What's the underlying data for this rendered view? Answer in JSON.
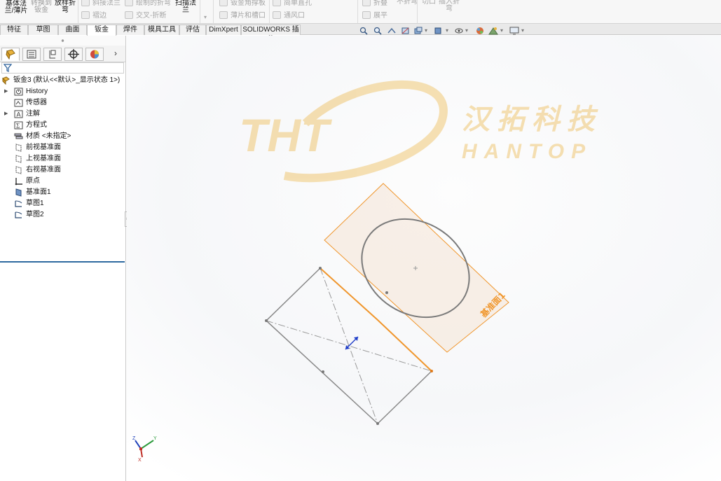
{
  "ribbon": {
    "big_buttons": [
      {
        "label": "基体法\n兰/薄片",
        "faded": false
      },
      {
        "label": "转换到\n钣金",
        "faded": true
      },
      {
        "label": "放样折\n弯",
        "faded": false
      },
      {
        "label": "扫描法\n兰",
        "faded": false
      }
    ],
    "small_buttons": [
      {
        "label": "斜接法兰"
      },
      {
        "label": "褶边"
      },
      {
        "label": "绘制的折弯"
      },
      {
        "label": "交叉-折断"
      },
      {
        "label": "钣金角撑板"
      },
      {
        "label": "薄片和槽口"
      },
      {
        "label": "简单直孔"
      },
      {
        "label": "通风口"
      },
      {
        "label": "折叠"
      },
      {
        "label": "不折弯"
      },
      {
        "label": "展平"
      },
      {
        "label": "切口"
      },
      {
        "label": "插入折\n弯"
      }
    ]
  },
  "command_tabs": [
    {
      "label": "特征",
      "active": false
    },
    {
      "label": "草图",
      "active": false
    },
    {
      "label": "曲面",
      "active": false
    },
    {
      "label": "钣金",
      "active": true
    },
    {
      "label": "焊件",
      "active": false
    },
    {
      "label": "模具工具",
      "active": false
    },
    {
      "label": "评估",
      "active": false
    },
    {
      "label": "DimXpert",
      "active": false
    },
    {
      "label": "SOLIDWORKS 插件",
      "active": false
    }
  ],
  "feature_tree": {
    "root": "钣金3 (默认<<默认>_显示状态 1>)",
    "items": [
      {
        "label": "History",
        "icon": "history-folder-icon",
        "expandable": true
      },
      {
        "label": "传感器",
        "icon": "sensor-icon",
        "expandable": false
      },
      {
        "label": "注解",
        "icon": "annotation-icon",
        "expandable": true
      },
      {
        "label": "方程式",
        "icon": "equation-icon",
        "expandable": false
      },
      {
        "label": "材质 <未指定>",
        "icon": "material-icon",
        "expandable": false
      },
      {
        "label": "前视基准面",
        "icon": "plane-icon",
        "expandable": false
      },
      {
        "label": "上视基准面",
        "icon": "plane-icon",
        "expandable": false
      },
      {
        "label": "右视基准面",
        "icon": "plane-icon",
        "expandable": false
      },
      {
        "label": "原点",
        "icon": "origin-icon",
        "expandable": false
      },
      {
        "label": "基准面1",
        "icon": "plane-filled-icon",
        "expandable": false
      },
      {
        "label": "草图1",
        "icon": "sketch-icon",
        "expandable": false
      },
      {
        "label": "草图2",
        "icon": "sketch-icon",
        "expandable": false
      }
    ]
  },
  "viewport": {
    "plane_label": "基准面1",
    "plane_color": "#f0962c",
    "watermark": {
      "logo": "THT",
      "cn": "汉拓科技",
      "en": "HANTOP",
      "color": "#f3d9a4"
    },
    "triad_labels": {
      "x": "X",
      "y": "Y",
      "z": "Z"
    }
  }
}
